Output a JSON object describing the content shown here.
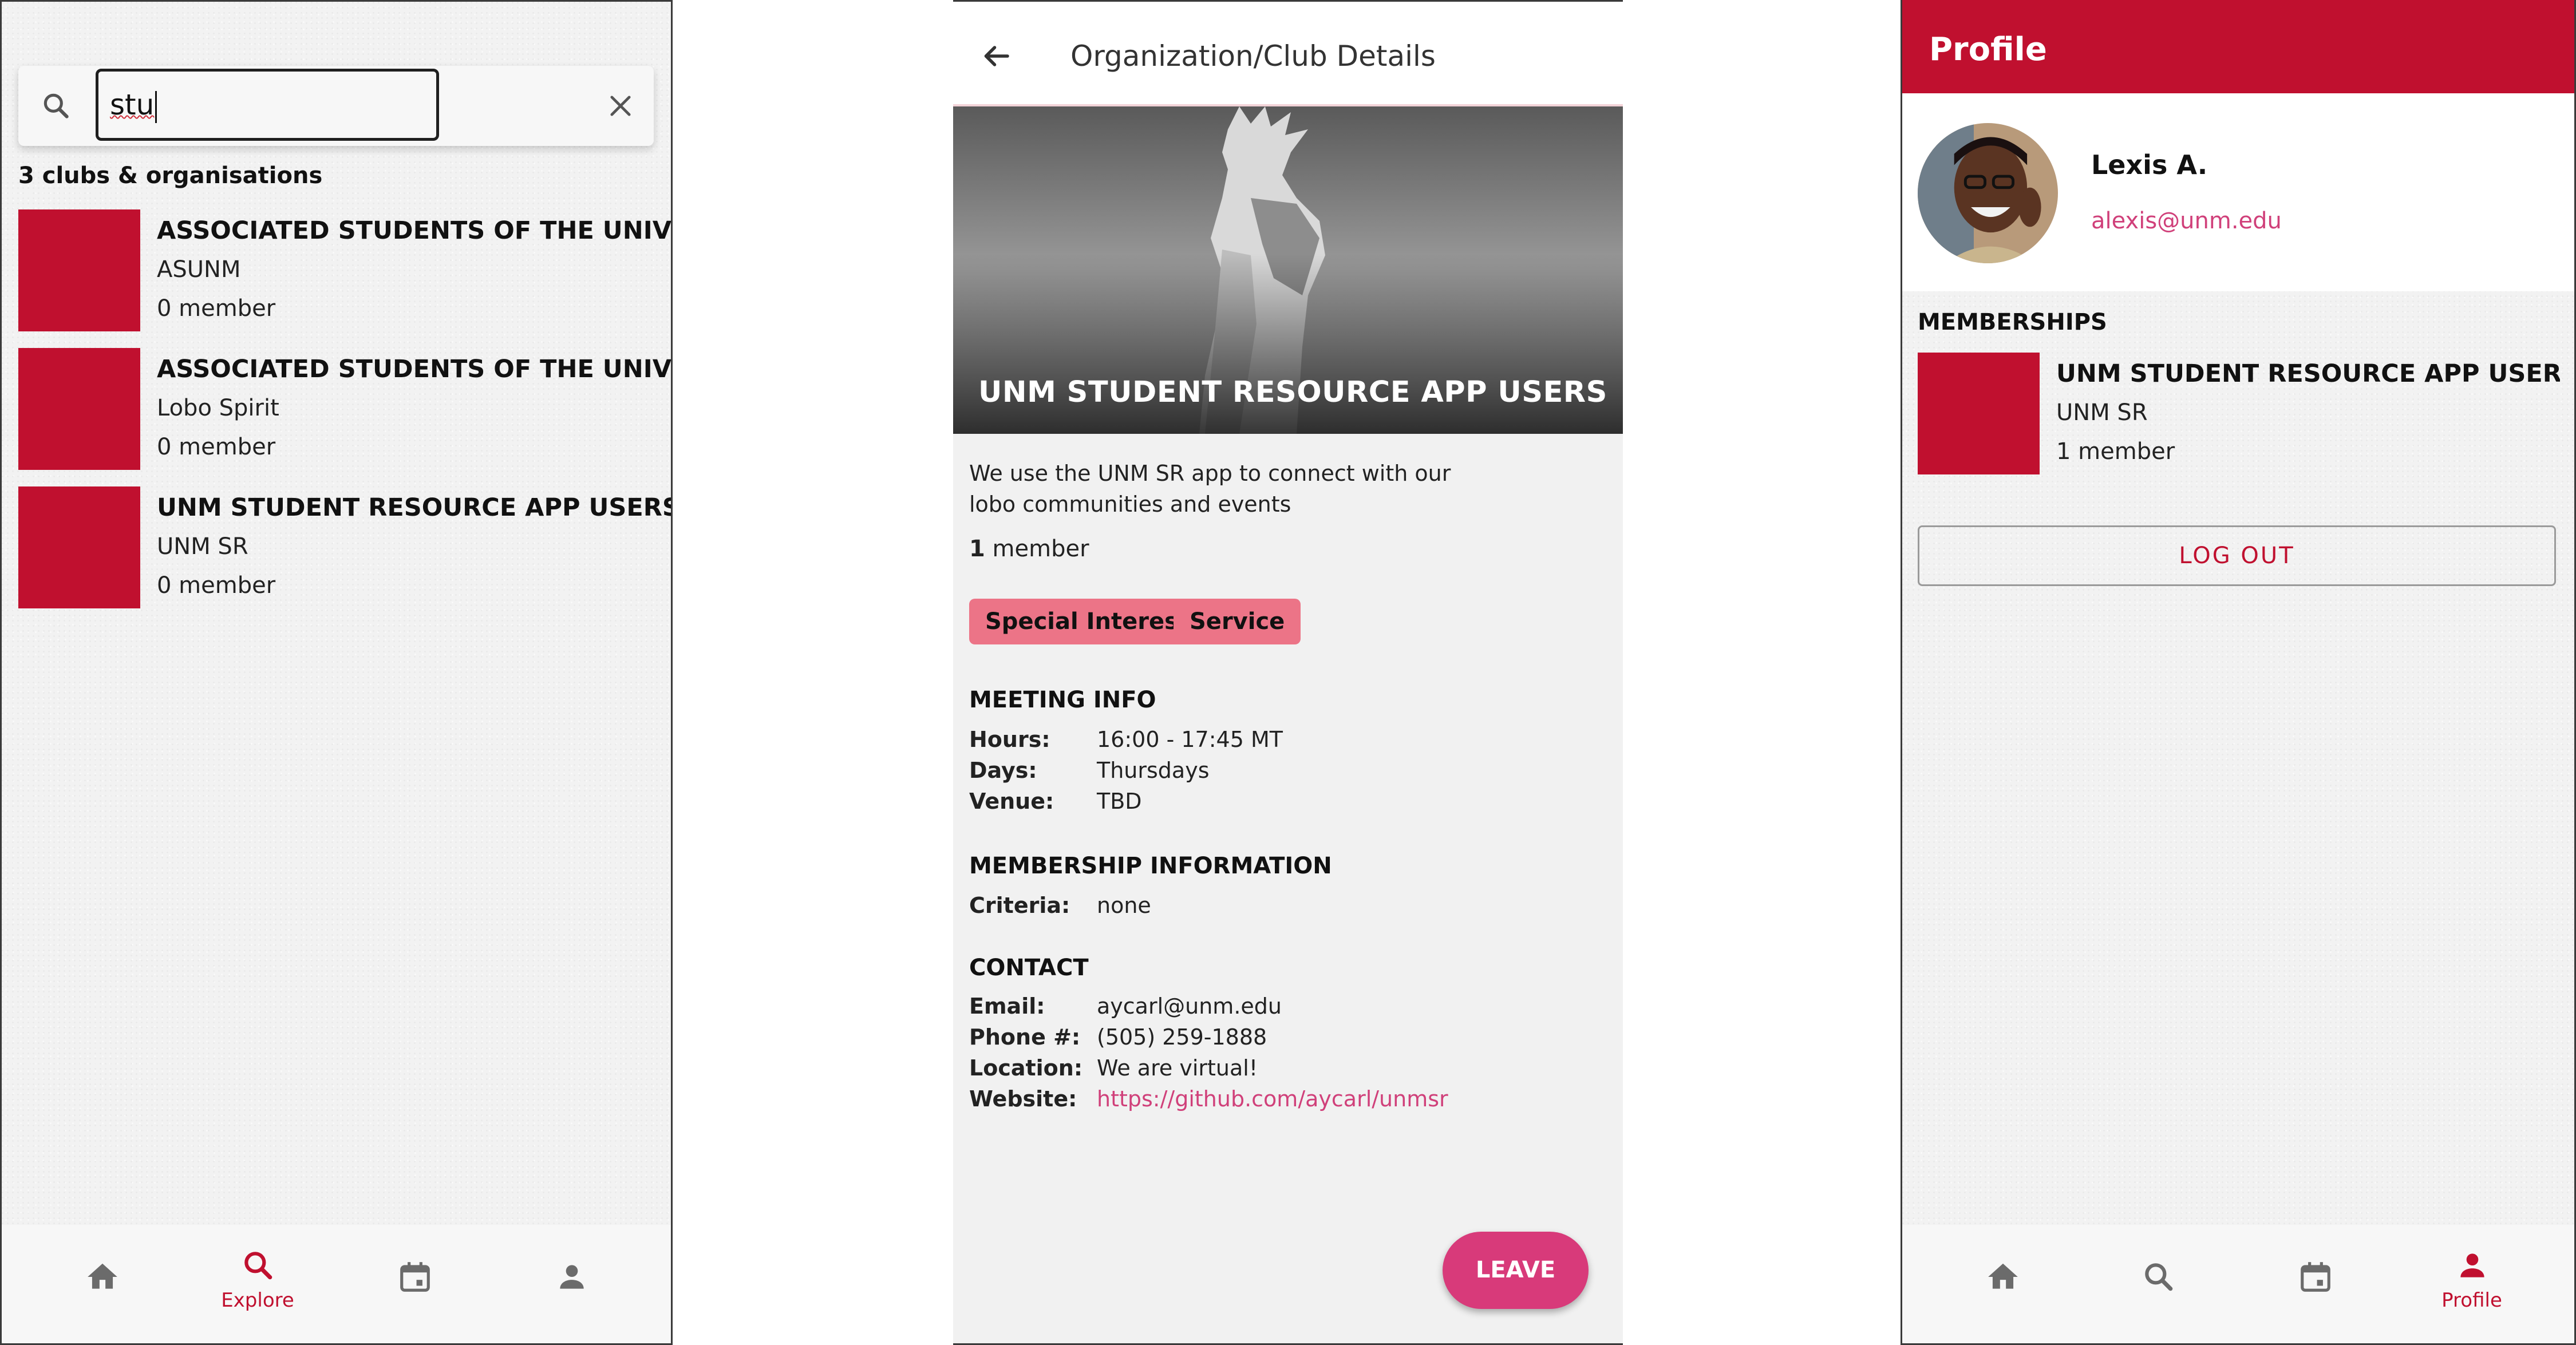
{
  "explore": {
    "search": {
      "value": "stu"
    },
    "results_count_label": "3 clubs & organisations",
    "results": [
      {
        "title": "ASSOCIATED STUDENTS OF THE UNIVERSIT",
        "subtitle": "ASUNM",
        "members": "0 member"
      },
      {
        "title": "ASSOCIATED STUDENTS OF THE UNIVERSIT",
        "subtitle": "Lobo Spirit",
        "members": "0 member"
      },
      {
        "title": "UNM STUDENT RESOURCE APP USERS",
        "subtitle": "UNM SR",
        "members": "0 member"
      }
    ],
    "nav": {
      "explore_label": "Explore"
    }
  },
  "detail": {
    "header_title": "Organization/Club Details",
    "hero_title": "UNM STUDENT RESOURCE APP USERS",
    "description": "We use the UNM SR app to connect with our lobo communities and events",
    "member_count": "1",
    "member_suffix": " member",
    "tags": [
      "Special Interest",
      "Service"
    ],
    "meeting": {
      "heading": "MEETING INFO",
      "hours_label": "Hours:",
      "hours": "16:00 - 17:45 MT",
      "days_label": "Days:",
      "days": "Thursdays",
      "venue_label": "Venue:",
      "venue": "TBD"
    },
    "membership": {
      "heading": "MEMBERSHIP INFORMATION",
      "criteria_label": "Criteria:",
      "criteria": "none"
    },
    "contact": {
      "heading": "CONTACT",
      "email_label": "Email:",
      "email": "aycarl@unm.edu",
      "phone_label": "Phone #:",
      "phone": "(505) 259-1888",
      "location_label": "Location:",
      "location": "We are virtual!",
      "website_label": "Website:",
      "website": "https://github.com/aycarl/unmsr"
    },
    "leave_label": "LEAVE"
  },
  "profile": {
    "header_title": "Profile",
    "name": "Lexis A.",
    "email": "alexis@unm.edu",
    "memberships_heading": "MEMBERSHIPS",
    "memberships": [
      {
        "title": "UNM STUDENT RESOURCE APP USERS",
        "subtitle": "UNM SR",
        "members": "1 member"
      }
    ],
    "logout_label": "LOG OUT",
    "nav": {
      "profile_label": "Profile"
    }
  },
  "colors": {
    "brand_red": "#c0102f",
    "accent_pink": "#d83a7a",
    "tag_pink": "#ec7487",
    "link_pink": "#d0407a"
  }
}
